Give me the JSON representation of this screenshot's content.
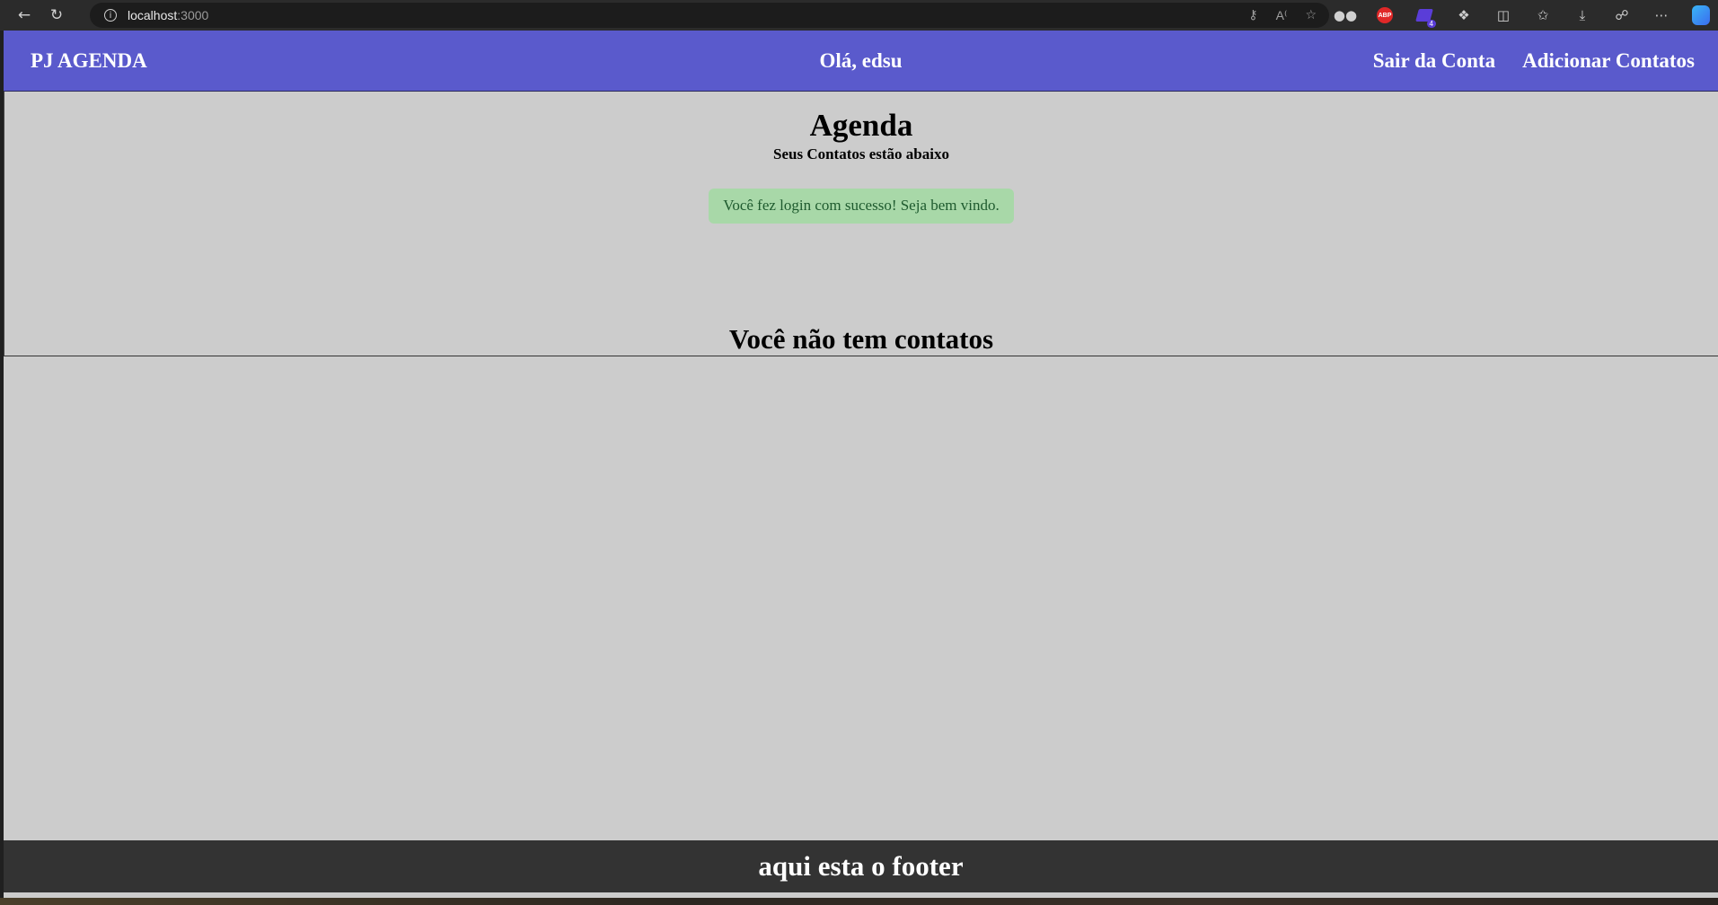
{
  "browser": {
    "url_host": "localhost",
    "url_port": ":3000"
  },
  "navbar": {
    "brand": "PJ AGENDA",
    "greeting": "Olá, edsu",
    "links": [
      {
        "label": "Sair da Conta"
      },
      {
        "label": "Adicionar Contatos"
      }
    ]
  },
  "main": {
    "title": "Agenda",
    "subtitle": "Seus Contatos estão abaixo",
    "alert": "Você fez login com sucesso! Seja bem vindo.",
    "empty_message": "Você não tem contatos"
  },
  "footer": {
    "text": "aqui esta o footer"
  },
  "colors": {
    "navbar": "#5a5acc",
    "page_bg": "#cccccc",
    "alert_bg": "#a8d8a8",
    "footer_bg": "#333333"
  },
  "icons": {
    "browser": [
      "back-icon",
      "reload-icon",
      "info-icon",
      "key-icon",
      "read-aloud-icon",
      "favorite-star-icon"
    ],
    "toolbar": [
      "extension-glasses-icon",
      "adblock-icon",
      "extension-badge-icon",
      "extensions-puzzle-icon",
      "split-screen-icon",
      "favorites-icon",
      "downloads-icon",
      "share-icon",
      "more-icon",
      "copilot-icon"
    ]
  },
  "toolbar": {
    "extension_badge_count": "4",
    "adblock_label": "ABP"
  }
}
